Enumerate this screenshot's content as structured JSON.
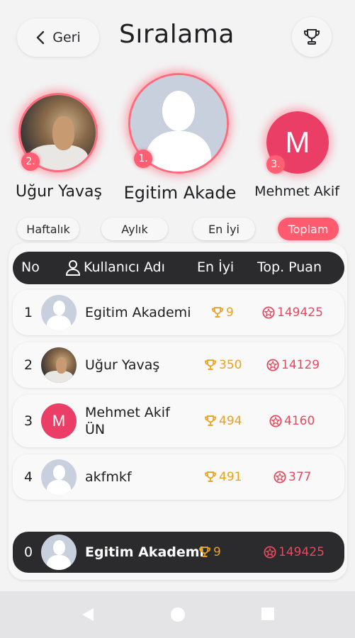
{
  "header": {
    "back_label": "Geri",
    "title": "Sıralama",
    "trophy_icon": "trophy-icon"
  },
  "podium": [
    {
      "rank": "2.",
      "name": "Uğur Yavaş",
      "avatar": "photo"
    },
    {
      "rank": "1.",
      "name": "Egitim Akade",
      "avatar": "placeholder"
    },
    {
      "rank": "3.",
      "name": "Mehmet Akif",
      "avatar": "letter",
      "letter": "M"
    }
  ],
  "tabs": [
    {
      "label": "Haftalık",
      "active": false
    },
    {
      "label": "Aylık",
      "active": false
    },
    {
      "label": "En İyi",
      "active": false
    },
    {
      "label": "Toplam",
      "active": true
    }
  ],
  "table": {
    "columns": {
      "no": "No",
      "username": "Kullanıcı Adı",
      "best": "En İyi",
      "total": "Top. Puan"
    },
    "rows": [
      {
        "rank": "1",
        "name": "Egitim Akademi",
        "best": "9",
        "total": "149425",
        "avatar": "placeholder"
      },
      {
        "rank": "2",
        "name": "Uğur Yavaş",
        "best": "350",
        "total": "14129",
        "avatar": "photo"
      },
      {
        "rank": "3",
        "name": "Mehmet Akif ÜN",
        "name_line1": "Mehmet Akif",
        "name_line2": "ÜN",
        "best": "494",
        "total": "4160",
        "avatar": "letter",
        "letter": "M"
      },
      {
        "rank": "4",
        "name": "akfmkf",
        "best": "491",
        "total": "377",
        "avatar": "placeholder"
      }
    ],
    "current_user": {
      "rank": "0",
      "name": "Egitim Akademi",
      "best": "9",
      "total": "149425"
    }
  },
  "colors": {
    "accent": "#ff5a6e",
    "best_gold": "#e9a21e",
    "total_red": "#e64a5e",
    "dark": "#2b2a2c",
    "letter_avatar": "#ea3e66"
  }
}
